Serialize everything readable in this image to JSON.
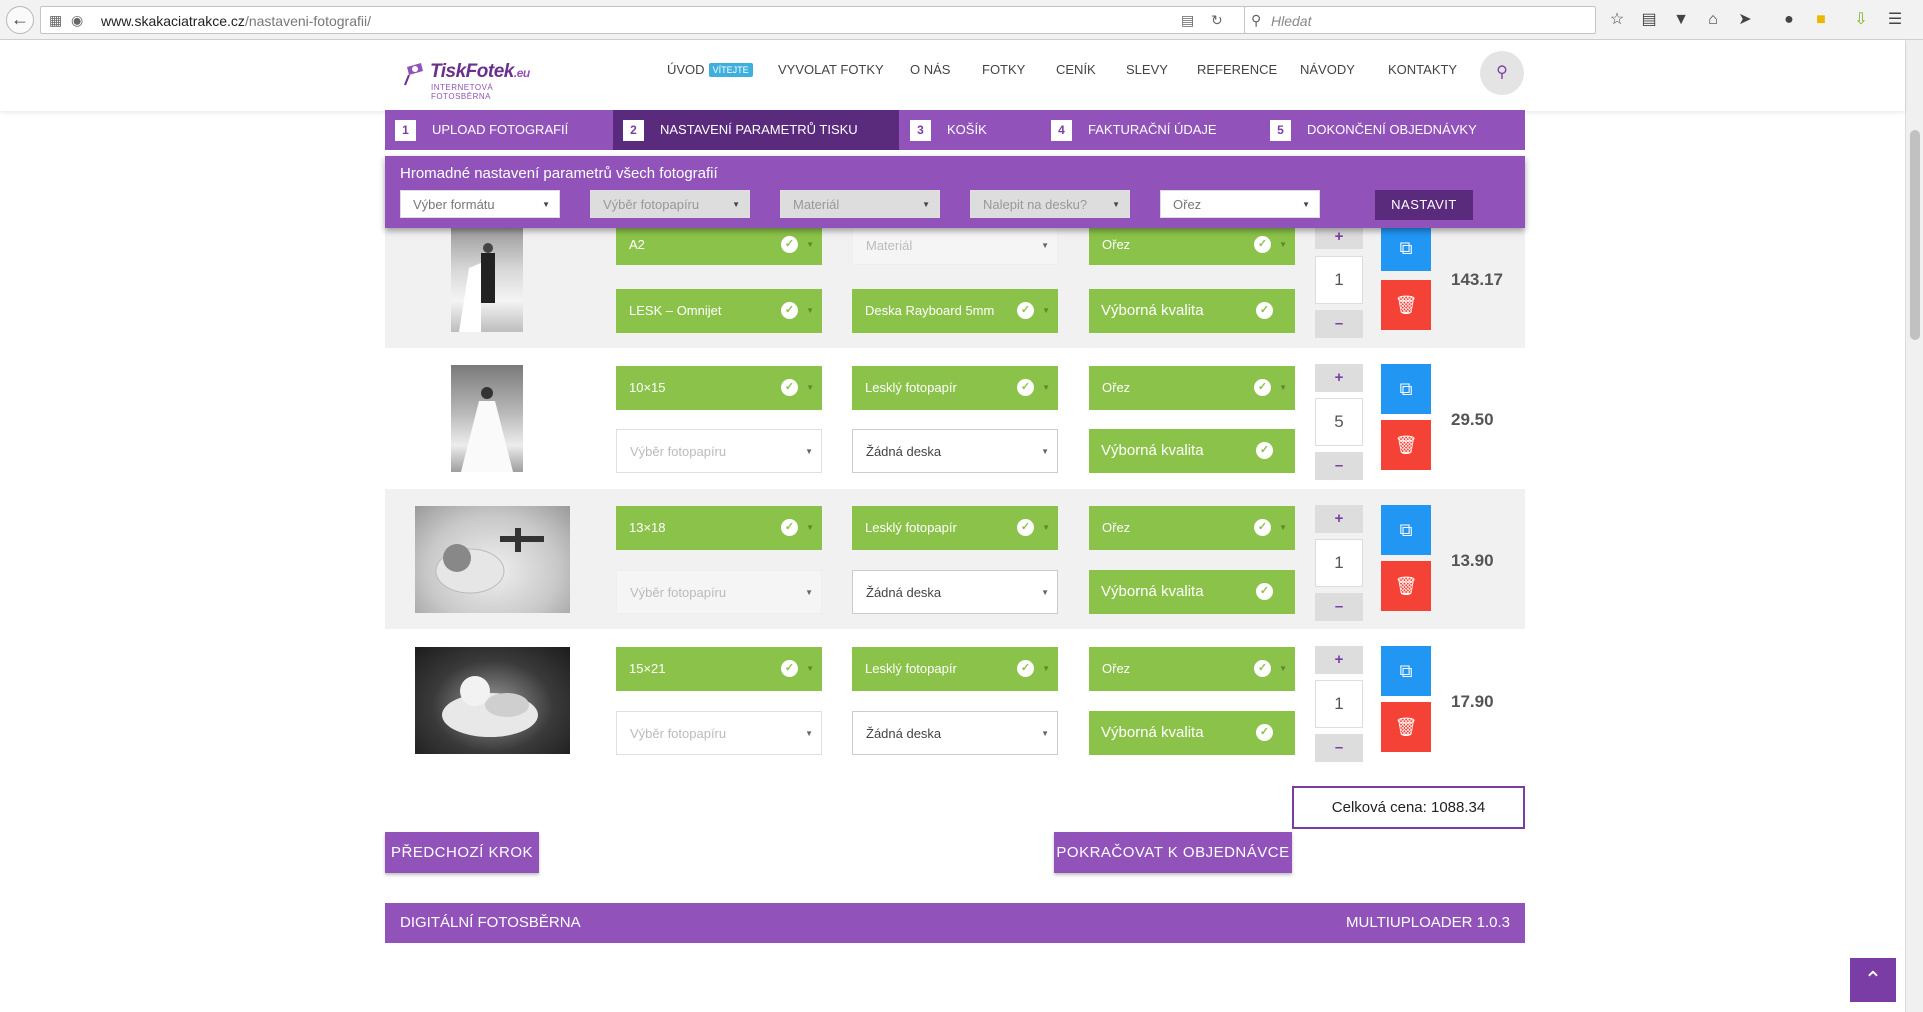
{
  "browser": {
    "url_domain": "www.skakaciatrakce.cz",
    "url_path": "/nastaveni-fotografii/",
    "search_placeholder": "Hledat"
  },
  "logo": {
    "name": "TiskFotek",
    "tld": ".eu",
    "tagline": "INTERNETOVÁ FOTOSBĚRNA"
  },
  "nav": {
    "items": [
      "ÚVOD",
      "VYVOLAT FOTKY",
      "O NÁS",
      "FOTKY",
      "CENÍK",
      "SLEVY",
      "REFERENCE",
      "NÁVODY",
      "KONTAKTY"
    ],
    "badge": "VÍTEJTE"
  },
  "steps": [
    {
      "num": "1",
      "label": "UPLOAD FOTOGRAFIÍ"
    },
    {
      "num": "2",
      "label": "NASTAVENÍ PARAMETRŮ TISKU"
    },
    {
      "num": "3",
      "label": "KOŠÍK"
    },
    {
      "num": "4",
      "label": "FAKTURAČNÍ ÚDAJE"
    },
    {
      "num": "5",
      "label": "DOKONČENÍ OBJEDNÁVKY"
    }
  ],
  "bulk": {
    "title": "Hromadné nastavení parametrů všech fotografií",
    "selects": [
      "Výber formátu",
      "Výběr fotopapíru",
      "Materiál",
      "Nalepit na desku?",
      "Ořez"
    ],
    "button": "NASTAVIT"
  },
  "rows": [
    {
      "format": "A2",
      "material": "Materiál",
      "crop": "Ořez",
      "paper": "LESK – Omnijet",
      "board": "Deska Rayboard 5mm",
      "quality": "Výborná kvalita",
      "qty": "1",
      "price": "143.17"
    },
    {
      "format": "10×15",
      "material": "Lesklý fotopapír",
      "crop": "Ořez",
      "paper": "Výběr fotopapíru",
      "board": "Žádná deska",
      "quality": "Výborná kvalita",
      "qty": "5",
      "price": "29.50"
    },
    {
      "format": "13×18",
      "material": "Lesklý fotopapír",
      "crop": "Ořez",
      "paper": "Výběr fotopapíru",
      "board": "Žádná deska",
      "quality": "Výborná kvalita",
      "qty": "1",
      "price": "13.90"
    },
    {
      "format": "15×21",
      "material": "Lesklý fotopapír",
      "crop": "Ořez",
      "paper": "Výběr fotopapíru",
      "board": "Žádná deska",
      "quality": "Výborná kvalita",
      "qty": "1",
      "price": "17.90"
    }
  ],
  "controls": {
    "plus": "+",
    "minus": "–"
  },
  "total": "Celková cena: 1088.34",
  "buttons": {
    "prev": "PŘEDCHOZÍ KROK",
    "next": "POKRAČOVAT K OBJEDNÁVCE"
  },
  "footer": {
    "left": "DIGITÁLNÍ FOTOSBĚRNA",
    "right": "MULTIUPLOADER 1.0.3"
  },
  "colors": {
    "purple": "#9153b9",
    "dark_purple": "#5a2a7c",
    "green": "#8bc34a",
    "blue": "#2196f3",
    "red": "#f44336"
  },
  "icons": [
    "back-arrow-icon",
    "search-icon",
    "copy-icon",
    "trash-icon",
    "check-icon",
    "chevron-up-icon"
  ]
}
